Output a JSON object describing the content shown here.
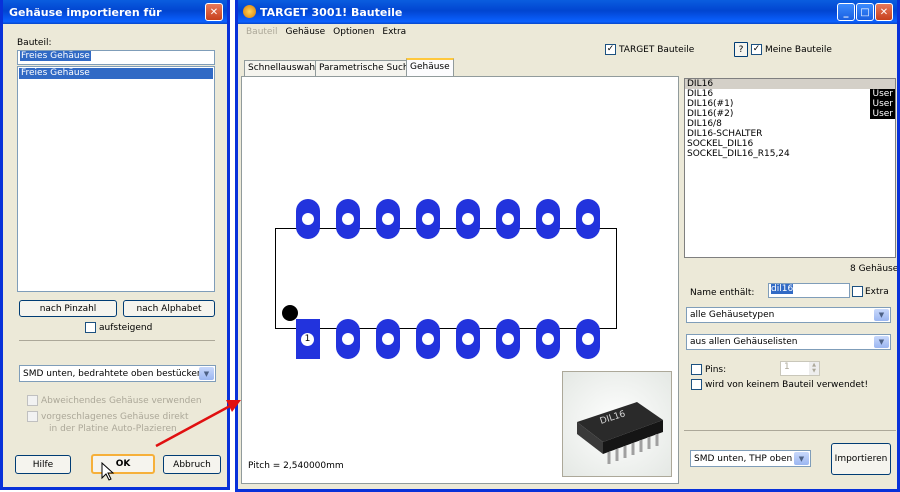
{
  "dialog": {
    "title": "Gehäuse importieren für",
    "bauteil_label": "Bauteil:",
    "bauteil_value": "Freies Gehäuse",
    "list_items": [
      "Freies Gehäuse"
    ],
    "sort_pinzahl": "nach Pinzahl",
    "sort_alphabet": "nach Alphabet",
    "aufsteigend": "aufsteigend",
    "mount_combo": "SMD unten, bedrahtete oben bestücken",
    "abweichendes": "Abweichendes Gehäuse verwenden",
    "vorgeschlagenes_1": "vorgeschlagenes Gehäuse direkt",
    "vorgeschlagenes_2": "in der Platine Auto-Plazieren",
    "hilfe": "Hilfe",
    "ok": "OK",
    "abbruch": "Abbruch"
  },
  "main": {
    "title": "TARGET 3001! Bauteile",
    "menu": [
      "Bauteil",
      "Gehäuse",
      "Optionen",
      "Extra"
    ],
    "target_bauteile": "TARGET Bauteile",
    "help_btn": "?",
    "meine_bauteile": "Meine Bauteile",
    "tabs": [
      "Schnellauswahl",
      "Parametrische Suche",
      "Gehäuse"
    ],
    "pitch": "Pitch = 2,540000mm",
    "pin1_label": "1",
    "chip_label": "DIL16",
    "package_list": [
      {
        "name": "DIL16",
        "user": ""
      },
      {
        "name": "DIL16",
        "user": "User"
      },
      {
        "name": "DIL16(#1)",
        "user": "User"
      },
      {
        "name": "DIL16(#2)",
        "user": "User"
      },
      {
        "name": "DIL16/8",
        "user": ""
      },
      {
        "name": "DIL16-SCHALTER",
        "user": ""
      },
      {
        "name": "SOCKEL_DIL16",
        "user": ""
      },
      {
        "name": "SOCKEL_DIL16_R15,24",
        "user": ""
      }
    ],
    "count": "8 Gehäuse",
    "name_label": "Name enthält:",
    "name_value": "dil16",
    "extra": "Extra",
    "type_combo": "alle Gehäusetypen",
    "list_combo": "aus allen Gehäuselisten",
    "pins_label": "Pins:",
    "pins_value": "1",
    "unused": "wird von keinem Bauteil verwendet!",
    "bottom_combo": "SMD unten, THP oben",
    "importieren": "Importieren"
  },
  "colors": {
    "pad": "#2233dd",
    "arrow": "#e01010",
    "title_blue": "#0a5ddf"
  }
}
